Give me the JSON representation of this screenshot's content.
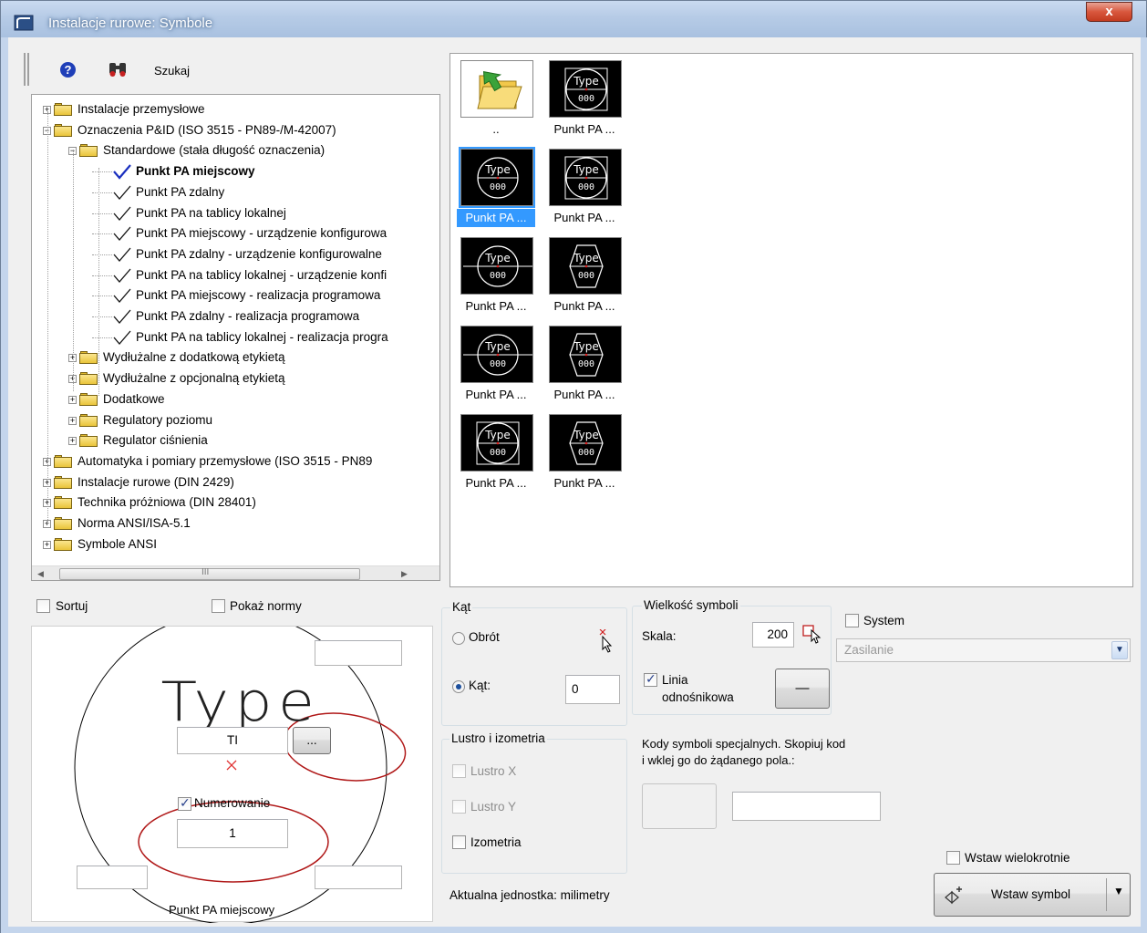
{
  "window": {
    "title": "Instalacje rurowe: Symbole",
    "close_label": "x"
  },
  "toolbar": {
    "help_label": "?",
    "search_label": "Szukaj"
  },
  "tree": {
    "items": [
      {
        "label": "Instalacje przemysłowe",
        "level": 0,
        "expander": "+"
      },
      {
        "label": "Oznaczenia P&ID (ISO 3515 - PN89-/M-42007)",
        "level": 0,
        "expander": "-"
      },
      {
        "label": "Standardowe (stała długość oznaczenia)",
        "level": 1,
        "expander": "-"
      },
      {
        "label": "Punkt PA miejscowy",
        "level": 2,
        "selected": true
      },
      {
        "label": "Punkt PA zdalny",
        "level": 2
      },
      {
        "label": "Punkt PA na tablicy lokalnej",
        "level": 2
      },
      {
        "label": "Punkt PA miejscowy - urządzenie konfigurowa",
        "level": 2
      },
      {
        "label": "Punkt PA zdalny - urządzenie konfigurowalne",
        "level": 2
      },
      {
        "label": "Punkt PA na tablicy lokalnej - urządzenie konfi",
        "level": 2
      },
      {
        "label": "Punkt PA miejscowy - realizacja programowa",
        "level": 2
      },
      {
        "label": "Punkt PA zdalny - realizacja programowa",
        "level": 2
      },
      {
        "label": "Punkt PA na tablicy lokalnej - realizacja progra",
        "level": 2
      },
      {
        "label": "Wydłużalne z dodatkową etykietą",
        "level": 1,
        "expander": "+"
      },
      {
        "label": "Wydłużalne z opcjonalną etykietą",
        "level": 1,
        "expander": "+"
      },
      {
        "label": "Dodatkowe",
        "level": 1,
        "expander": "+"
      },
      {
        "label": "Regulatory poziomu",
        "level": 1,
        "expander": "+"
      },
      {
        "label": "Regulator ciśnienia",
        "level": 1,
        "expander": "+"
      },
      {
        "label": "Automatyka i pomiary przemysłowe (ISO 3515 - PN89",
        "level": 0,
        "expander": "+"
      },
      {
        "label": "Instalacje rurowe (DIN 2429)",
        "level": 0,
        "expander": "+"
      },
      {
        "label": "Technika próżniowa (DIN 28401)",
        "level": 0,
        "expander": "+"
      },
      {
        "label": "Norma ANSI/ISA-5.1",
        "level": 0,
        "expander": "+"
      },
      {
        "label": "Symbole ANSI",
        "level": 0,
        "expander": "+"
      }
    ],
    "hscroll_mark": "III"
  },
  "thumbnails": {
    "up_label": "..",
    "symbol_text": "Type",
    "symbol_num": "000",
    "items": [
      {
        "caption": "Punkt PA ...",
        "style": "circle-box"
      },
      {
        "caption": "Punkt PA ...",
        "style": "circle",
        "selected": true
      },
      {
        "caption": "Punkt PA ...",
        "style": "circle-box"
      },
      {
        "caption": "Punkt PA ...",
        "style": "circle-line"
      },
      {
        "caption": "Punkt PA ...",
        "style": "hexagon"
      },
      {
        "caption": "Punkt PA ...",
        "style": "circle-line"
      },
      {
        "caption": "Punkt PA ...",
        "style": "hexagon"
      },
      {
        "caption": "Punkt PA ...",
        "style": "circle-box"
      },
      {
        "caption": "Punkt PA ...",
        "style": "hexagon"
      }
    ]
  },
  "options": {
    "sort_label": "Sortuj",
    "show_norms_label": "Pokaż normy"
  },
  "preview": {
    "type_text": "Type",
    "type_field_value": "TI",
    "ellipsis_label": "...",
    "numbering_label": "Numerowanie",
    "number_value": "1",
    "caption": "Punkt PA miejscowy"
  },
  "angle": {
    "title": "Kąt",
    "rotation_label": "Obrót",
    "angle_label": "Kąt:",
    "angle_value": "0"
  },
  "size": {
    "title": "Wielkość symboli",
    "scale_label": "Skala:",
    "scale_value": "200",
    "leader_label_1": "Linia",
    "leader_label_2": "odnośnikowa",
    "leader_style": "—"
  },
  "system": {
    "label": "System",
    "combo_value": "Zasilanie"
  },
  "mirror": {
    "title": "Lustro i izometria",
    "mirror_x": "Lustro X",
    "mirror_y": "Lustro Y",
    "isometry": "Izometria"
  },
  "codes": {
    "label_line1": "Kody symboli specjalnych. Skopiuj kod",
    "label_line2": "i wklej go do żądanego pola.:"
  },
  "units_label": "Aktualna jednostka: milimetry",
  "insert": {
    "multiple_label": "Wstaw wielokrotnie",
    "insert_label": "Wstaw symbol"
  }
}
